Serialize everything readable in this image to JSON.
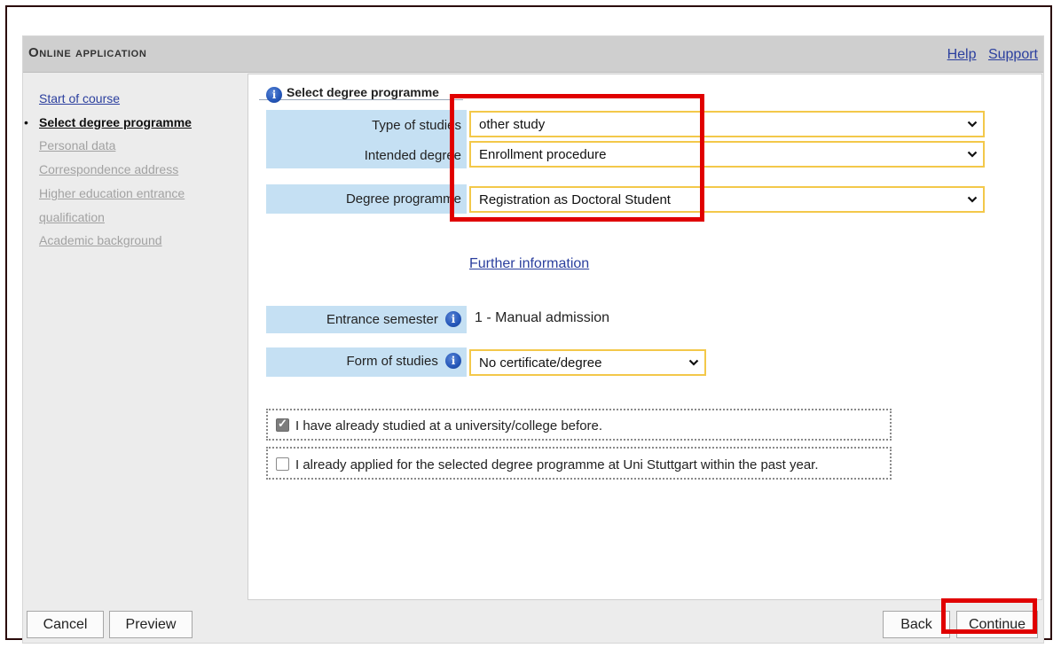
{
  "header": {
    "title": "Online application",
    "help_link": "Help",
    "support_link": "Support"
  },
  "sidebar": {
    "items": [
      {
        "label": "Start of course",
        "state": "link"
      },
      {
        "label": "Select degree programme",
        "state": "current"
      },
      {
        "label": "Personal data",
        "state": "disabled"
      },
      {
        "label": "Correspondence address",
        "state": "disabled"
      },
      {
        "label": "Higher education entrance",
        "state": "disabled"
      },
      {
        "label": "qualification",
        "state": "disabled"
      },
      {
        "label": "Academic background",
        "state": "disabled"
      }
    ]
  },
  "section": {
    "title": "Select degree programme"
  },
  "form": {
    "type_of_studies": {
      "label": "Type of studies",
      "value": "other study"
    },
    "intended_degree": {
      "label": "Intended degree",
      "value": "Enrollment procedure"
    },
    "degree_programme": {
      "label": "Degree programme",
      "value": "Registration as Doctoral Student"
    },
    "further_info_link": "Further information",
    "entrance_semester": {
      "label": "Entrance semester",
      "value": "1 - Manual admission"
    },
    "form_of_studies": {
      "label": "Form of studies",
      "value": "No certificate/degree"
    }
  },
  "checkboxes": {
    "studied_before": {
      "label": "I have already studied at a university/college before.",
      "checked": true
    },
    "applied_before": {
      "label": "I already applied for the selected degree programme at Uni Stuttgart within the past year.",
      "checked": false
    }
  },
  "footer": {
    "cancel_label": "Cancel",
    "preview_label": "Preview",
    "back_label": "Back",
    "continue_label": "Continue"
  },
  "icons": {
    "info": "info-icon",
    "dropdown": "chevron-down-icon"
  },
  "colors": {
    "label_bg": "#c5e0f3",
    "select_border": "#f3c84a",
    "highlight": "#e00000",
    "link": "#2b3f9e"
  }
}
